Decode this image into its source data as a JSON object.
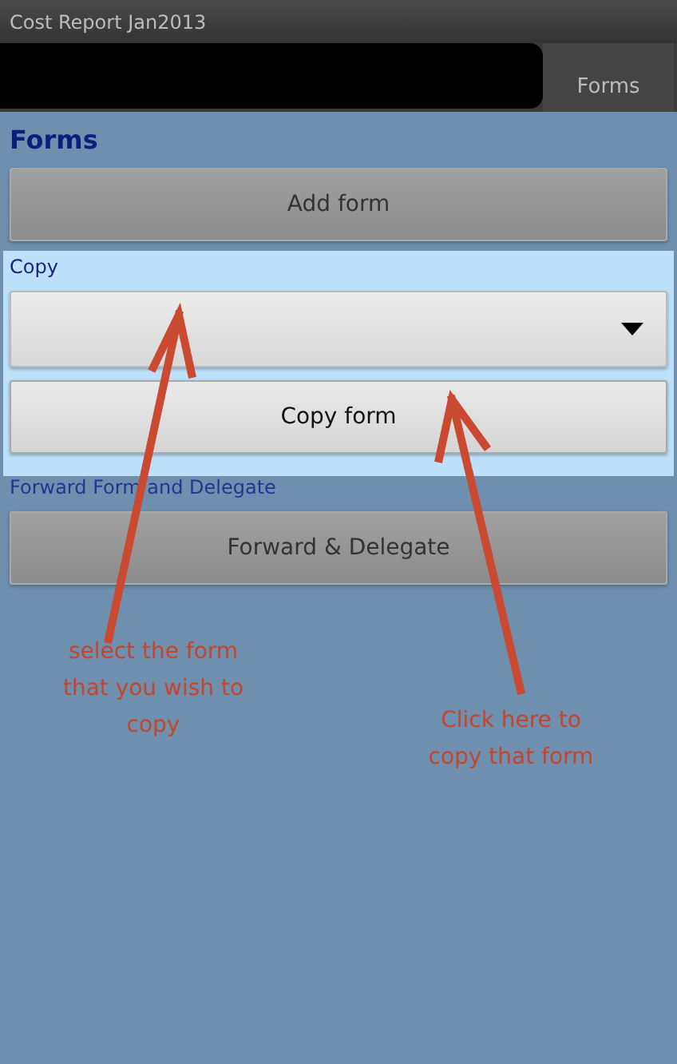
{
  "window": {
    "title": "Cost Report Jan2013"
  },
  "tabs": [
    {
      "kind": "tab",
      "label": "Forms",
      "selected": false
    }
  ],
  "sections": [
    {
      "heading": "Forms",
      "highlighted": false,
      "controls": [
        {
          "kind": "button",
          "label": "Add form"
        }
      ]
    },
    {
      "heading": "Copy",
      "highlighted": true,
      "controls": [
        {
          "kind": "dropdown"
        },
        {
          "kind": "button",
          "label": "Copy form"
        }
      ]
    },
    {
      "heading": "Forward Form and Delegate",
      "highlighted": false,
      "controls": [
        {
          "kind": "button",
          "label": "Forward & Delegate"
        }
      ]
    }
  ],
  "annotations": [
    "select the form\nthat you wish to\ncopy",
    "Click here to\ncopy that form"
  ]
}
